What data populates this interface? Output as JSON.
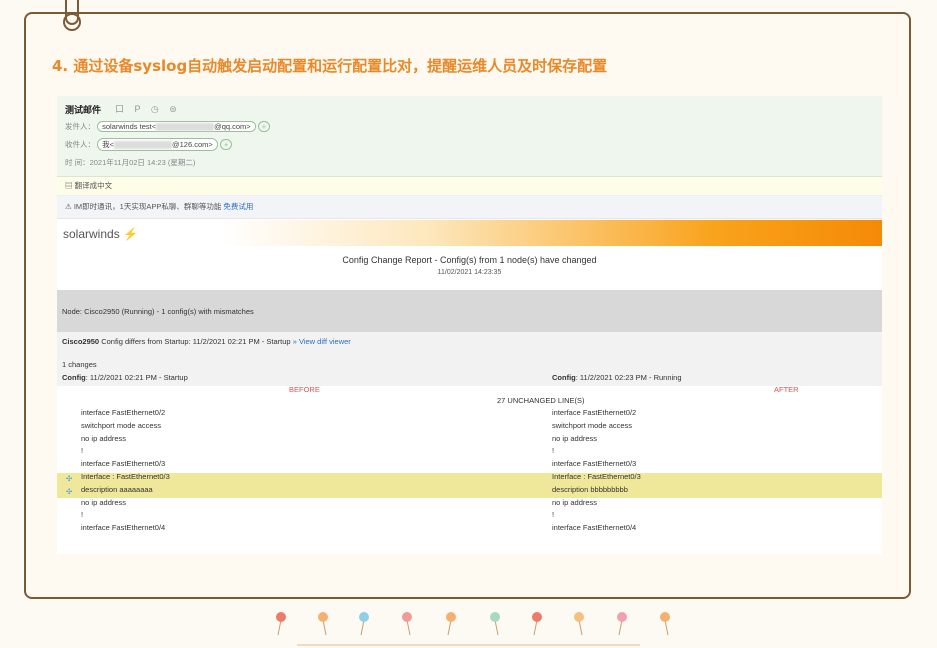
{
  "heading": "4. 通过设备syslog自动触发启动配置和运行配置比对，提醒运维人员及时保存配置",
  "mail": {
    "subject": "测试邮件",
    "subject_icons": "口 P ◷ ⊜",
    "from_label": "发件人：",
    "from_name": "solarwinds test<",
    "from_domain": "@qq.com>",
    "to_label": "收件人：",
    "to_name": "我<",
    "to_domain": "@126.com>",
    "plus": "+",
    "time_label": "时  间：",
    "time_value": "2021年11月02日 14:23 (星期二)",
    "translate_text": "翻译成中文",
    "tip_text": "IM即时通讯，1天实现APP私聊、群聊等功能",
    "tip_link": "免费试用"
  },
  "report": {
    "logo": "solarwinds",
    "title": "Config Change Report - Config(s) from 1 node(s) have changed",
    "date": "11/02/2021 14:23:35",
    "node": "Node: Cisco2950 (Running) - 1 config(s) with mismatches",
    "diff_device": "Cisco2950",
    "diff_text": " Config differs from Startup: 11/2/2021 02:21 PM - Startup",
    "diff_link": "» View diff viewer",
    "changes": "1 changes",
    "config_label": "Config",
    "left_config": ": 11/2/2021 02:21 PM - Startup",
    "right_config": ": 11/2/2021 02:23 PM - Running",
    "before": "BEFORE",
    "after": "AFTER",
    "unchanged": "27 UNCHANGED LINE(S)",
    "lines_left": [
      "interface FastEthernet0/2",
      "switchport mode access",
      "no ip address",
      "!",
      "interface FastEthernet0/3",
      "Interface : FastEthernet0/3",
      "description aaaaaaaa",
      "no ip address",
      "!",
      "interface FastEthernet0/4"
    ],
    "lines_right": [
      "interface FastEthernet0/2",
      "switchport mode access",
      "no ip address",
      "!",
      "interface FastEthernet0/3",
      "Interface : FastEthernet0/3",
      "description bbbbbbbbb",
      "no ip address",
      "!",
      "interface FastEthernet0/4"
    ]
  },
  "colors": {
    "heading": "#e8892a",
    "frame": "#7a5a36",
    "highlight": "#efe79a",
    "accent_orange": "#f58a07"
  }
}
